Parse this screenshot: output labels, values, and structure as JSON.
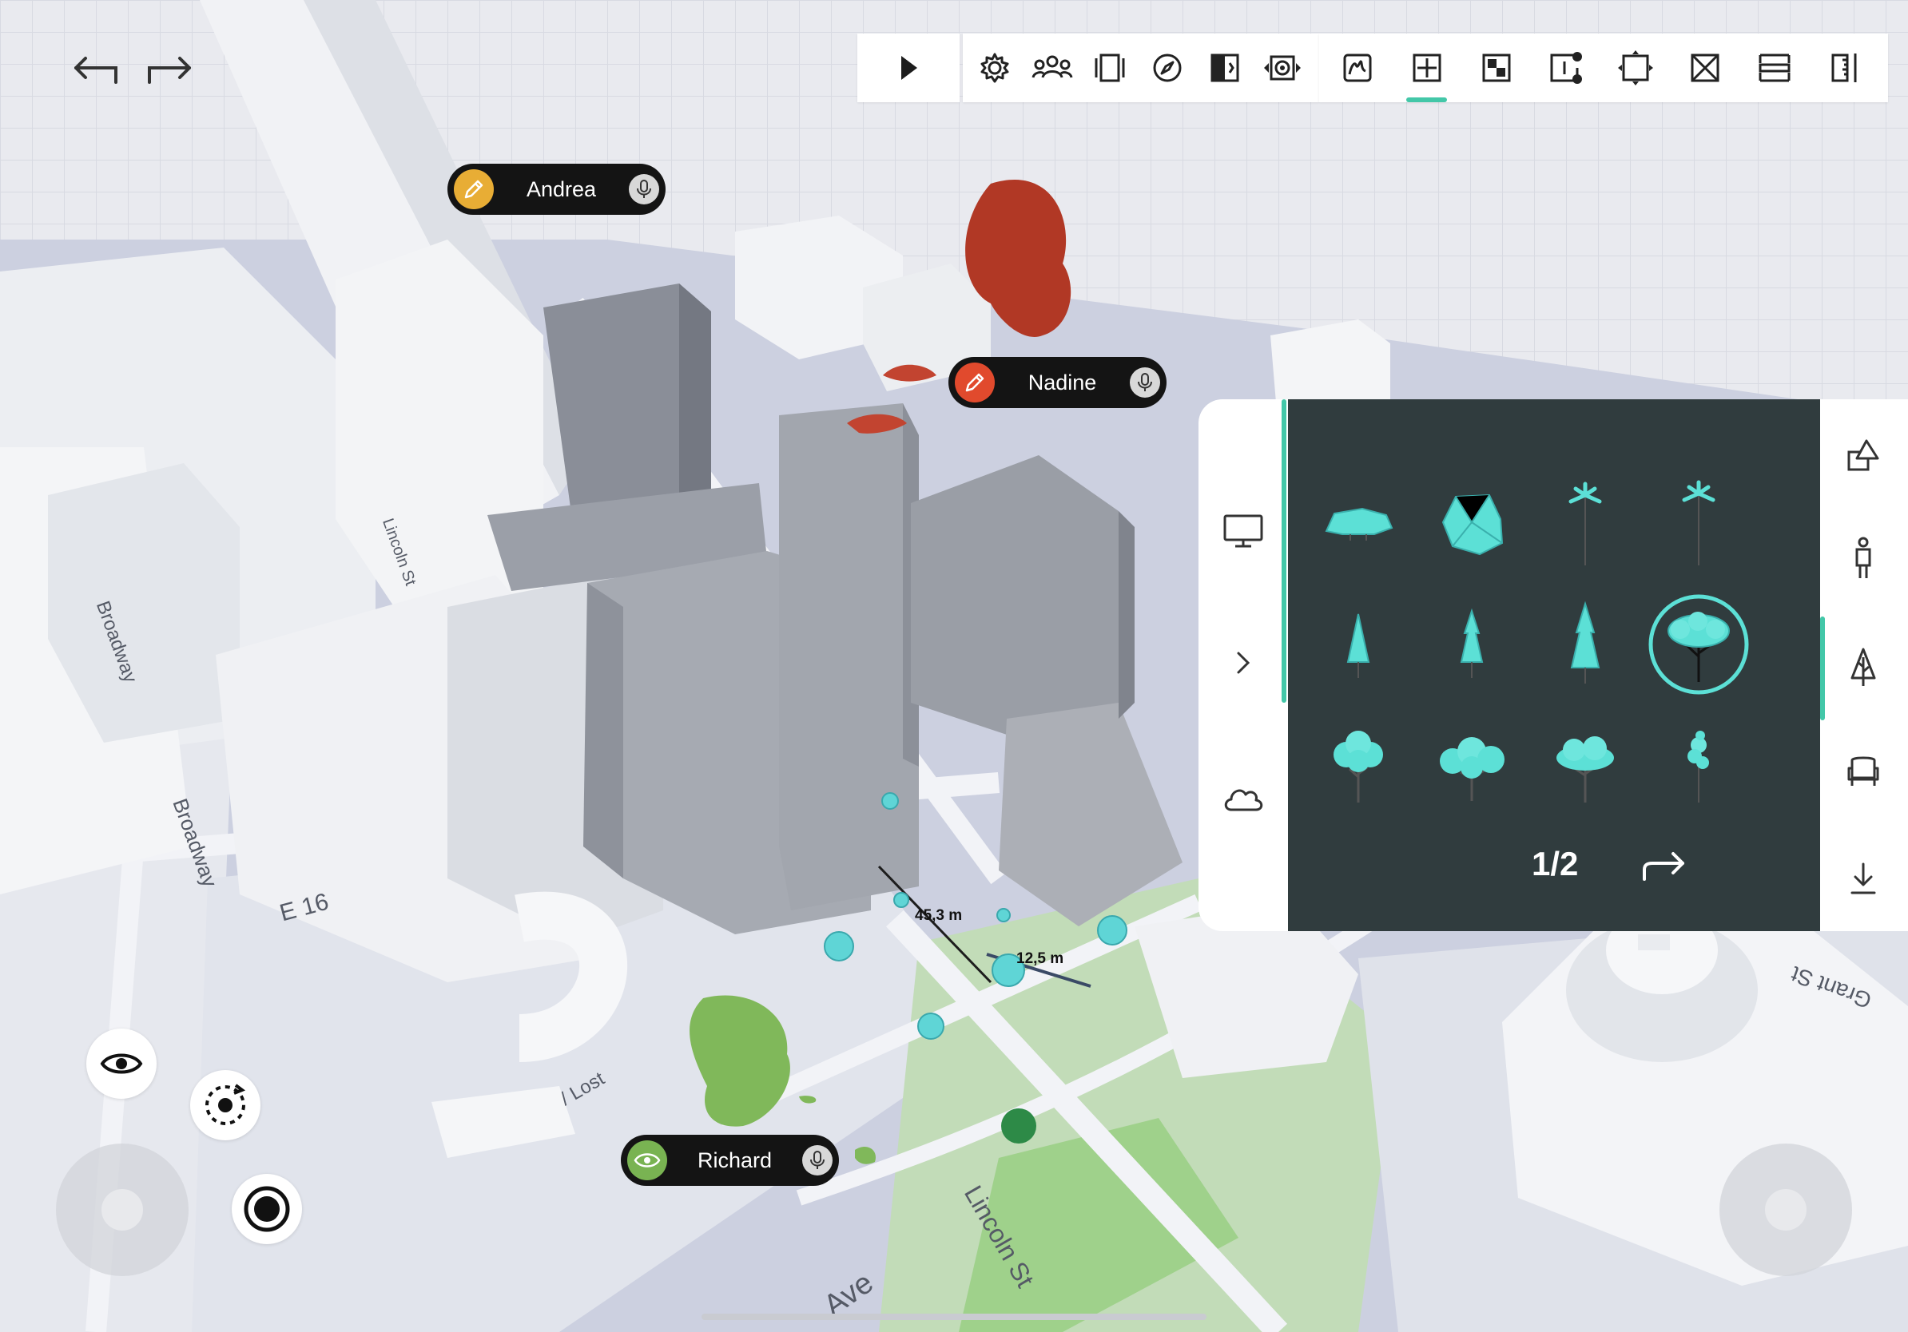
{
  "history": {
    "undo_icon": "undo-icon",
    "redo_icon": "redo-icon"
  },
  "toolbar": {
    "play_icon": "play-icon",
    "group_a_icons": [
      "settings-icon",
      "collaborators-icon",
      "panels-icon",
      "compass-icon",
      "split-view-icon",
      "render-settings-icon"
    ],
    "group_b_icons": [
      "sketch-tool-icon",
      "add-area-icon",
      "pattern-icon",
      "annotation-icon",
      "bounds-icon",
      "remove-icon",
      "section-icon",
      "measure-icon"
    ],
    "active_tool": "add-area-icon"
  },
  "users": [
    {
      "name": "Andrea",
      "mode": "pencil-icon",
      "color": "#e8ad35"
    },
    {
      "name": "Nadine",
      "mode": "pencil-icon",
      "color": "#e14a2d"
    },
    {
      "name": "Richard",
      "mode": "eye-icon",
      "color": "#79b352"
    }
  ],
  "measurements": [
    "45,3 m",
    "12,5 m"
  ],
  "streets": [
    "Broadway",
    "Broadway",
    "Lincoln St",
    "Lincoln St",
    "E 16",
    "Grant St",
    "Ave",
    "/ Lost"
  ],
  "library": {
    "page": "1/2",
    "left_icons": [
      "monitor-icon",
      "expand-chevron-icon",
      "cloud-icon"
    ],
    "right_icons": [
      "shapes-icon",
      "person-icon",
      "tree-category-icon",
      "furniture-icon",
      "download-icon"
    ],
    "active_category": "tree-category-icon",
    "selected_item": 8,
    "accent_color": "#5ce0d6",
    "items": [
      "bush",
      "rock-bush",
      "palm",
      "palm-tall",
      "conifer-small",
      "conifer-medium",
      "conifer-large",
      "round-tree",
      "broadleaf-tree",
      "wide-tree",
      "oak-tree",
      "slim-tree"
    ]
  },
  "controls": {
    "view_icon": "eye-icon",
    "orbit_icon": "orbit-icon",
    "record_icon": "record-icon"
  }
}
